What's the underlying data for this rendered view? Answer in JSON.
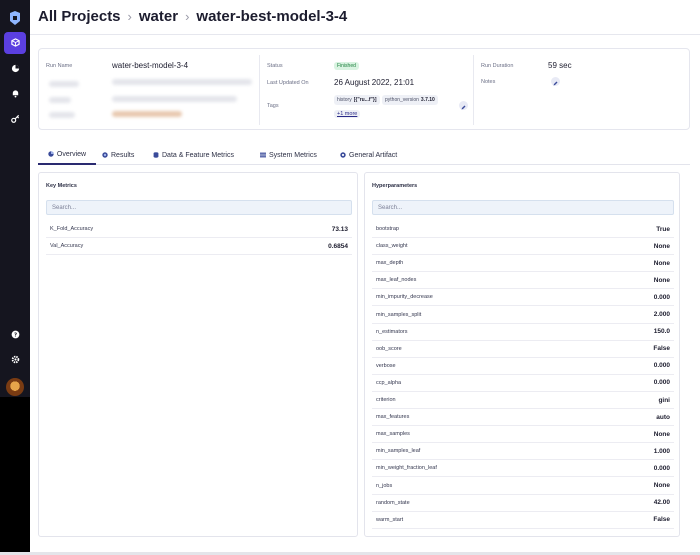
{
  "breadcrumb": {
    "root": "All Projects",
    "project": "water",
    "run": "water-best-model-3-4"
  },
  "run_info": {
    "run_name_label": "Run Name",
    "run_name": "water-best-model-3-4",
    "status_label": "Status",
    "status": "Finished",
    "last_updated_label": "Last Updated On",
    "last_updated": "26 August 2022, 21:01",
    "tags_label": "Tags",
    "tag1_key": "history",
    "tag1_value": "[{\"ru...f\"}]",
    "tag2_key": "python_version",
    "tag2_value": "3.7.10",
    "more_tags": "+1 more",
    "duration_label": "Run Duration",
    "duration": "59 sec",
    "notes_label": "Notes"
  },
  "tabs": [
    {
      "label": "Overview",
      "icon": "overview-icon"
    },
    {
      "label": "Results",
      "icon": "results-icon"
    },
    {
      "label": "Data & Feature Metrics",
      "icon": "data-icon"
    },
    {
      "label": "System Metrics",
      "icon": "system-icon"
    },
    {
      "label": "General Artifact",
      "icon": "artifact-icon"
    }
  ],
  "key_metrics": {
    "title": "Key Metrics",
    "search_placeholder": "Search...",
    "rows": [
      {
        "name": "K_Fold_Accuracy",
        "value": "73.13"
      },
      {
        "name": "Val_Accuracy",
        "value": "0.6854"
      }
    ]
  },
  "hyperparameters": {
    "title": "Hyperparameters",
    "search_placeholder": "Search...",
    "rows": [
      {
        "name": "bootstrap",
        "value": "True"
      },
      {
        "name": "class_weight",
        "value": "None"
      },
      {
        "name": "max_depth",
        "value": "None"
      },
      {
        "name": "max_leaf_nodes",
        "value": "None"
      },
      {
        "name": "min_impurity_decrease",
        "value": "0.000"
      },
      {
        "name": "min_samples_split",
        "value": "2.000"
      },
      {
        "name": "n_estimators",
        "value": "150.0"
      },
      {
        "name": "oob_score",
        "value": "False"
      },
      {
        "name": "verbose",
        "value": "0.000"
      },
      {
        "name": "ccp_alpha",
        "value": "0.000"
      },
      {
        "name": "criterion",
        "value": "gini"
      },
      {
        "name": "max_features",
        "value": "auto"
      },
      {
        "name": "max_samples",
        "value": "None"
      },
      {
        "name": "min_samples_leaf",
        "value": "1.000"
      },
      {
        "name": "min_weight_fraction_leaf",
        "value": "0.000"
      },
      {
        "name": "n_jobs",
        "value": "None"
      },
      {
        "name": "random_state",
        "value": "42.00"
      },
      {
        "name": "warm_start",
        "value": "False"
      }
    ]
  },
  "colors": {
    "accent": "#5b3fe0",
    "sidebar": "#15151f",
    "finished": "#1b7f3c"
  }
}
